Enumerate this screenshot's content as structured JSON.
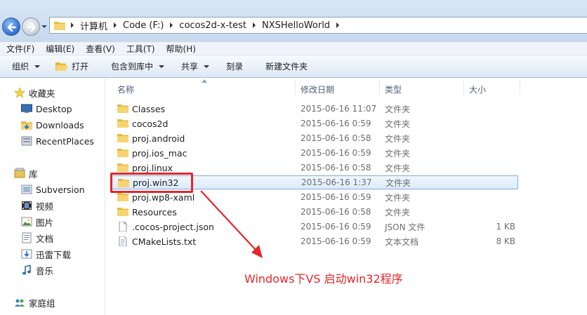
{
  "breadcrumb": [
    "计算机",
    "Code (F:)",
    "cocos2d-x-test",
    "NXSHelloWorld"
  ],
  "menu": [
    "文件(F)",
    "编辑(E)",
    "查看(V)",
    "工具(T)",
    "帮助(H)"
  ],
  "toolbar": {
    "organize": "组织",
    "open": "打开",
    "include_library": "包含到库中",
    "share": "共享",
    "burn": "刻录",
    "new_folder": "新建文件夹"
  },
  "nav": {
    "favorites": "收藏夹",
    "desktop": "Desktop",
    "downloads": "Downloads",
    "recent": "RecentPlaces",
    "libraries": "库",
    "subversion": "Subversion",
    "videos": "视频",
    "pictures": "图片",
    "documents": "文档",
    "xunlei": "迅雷下载",
    "music": "音乐",
    "homegroup": "家庭组"
  },
  "columns": {
    "name": "名称",
    "modified": "修改日期",
    "type": "类型",
    "size": "大小"
  },
  "files": [
    {
      "name": "Classes",
      "date": "2015-06-16 11:07",
      "type": "文件夹",
      "size": "",
      "kind": "folder"
    },
    {
      "name": "cocos2d",
      "date": "2015-06-16 0:59",
      "type": "文件夹",
      "size": "",
      "kind": "folder"
    },
    {
      "name": "proj.android",
      "date": "2015-06-16 0:58",
      "type": "文件夹",
      "size": "",
      "kind": "folder"
    },
    {
      "name": "proj.ios_mac",
      "date": "2015-06-16 0:59",
      "type": "文件夹",
      "size": "",
      "kind": "folder"
    },
    {
      "name": "proj.linux",
      "date": "2015-06-16 0:58",
      "type": "文件夹",
      "size": "",
      "kind": "folder"
    },
    {
      "name": "proj.win32",
      "date": "2015-06-16 1:37",
      "type": "文件夹",
      "size": "",
      "kind": "folder",
      "selected": true
    },
    {
      "name": "proj.wp8-xaml",
      "date": "2015-06-16 0:59",
      "type": "文件夹",
      "size": "",
      "kind": "folder"
    },
    {
      "name": "Resources",
      "date": "2015-06-16 0:58",
      "type": "文件夹",
      "size": "",
      "kind": "folder"
    },
    {
      "name": ".cocos-project.json",
      "date": "2015-06-16 0:59",
      "type": "JSON 文件",
      "size": "1 KB",
      "kind": "file"
    },
    {
      "name": "CMakeLists.txt",
      "date": "2015-06-16 0:59",
      "type": "文本文档",
      "size": "8 KB",
      "kind": "file"
    }
  ],
  "annotation": "Windows下VS 启动win32程序",
  "colors": {
    "annotation": "#e5262a",
    "selection": "#dcebfc",
    "folder": "#f0c44c"
  }
}
